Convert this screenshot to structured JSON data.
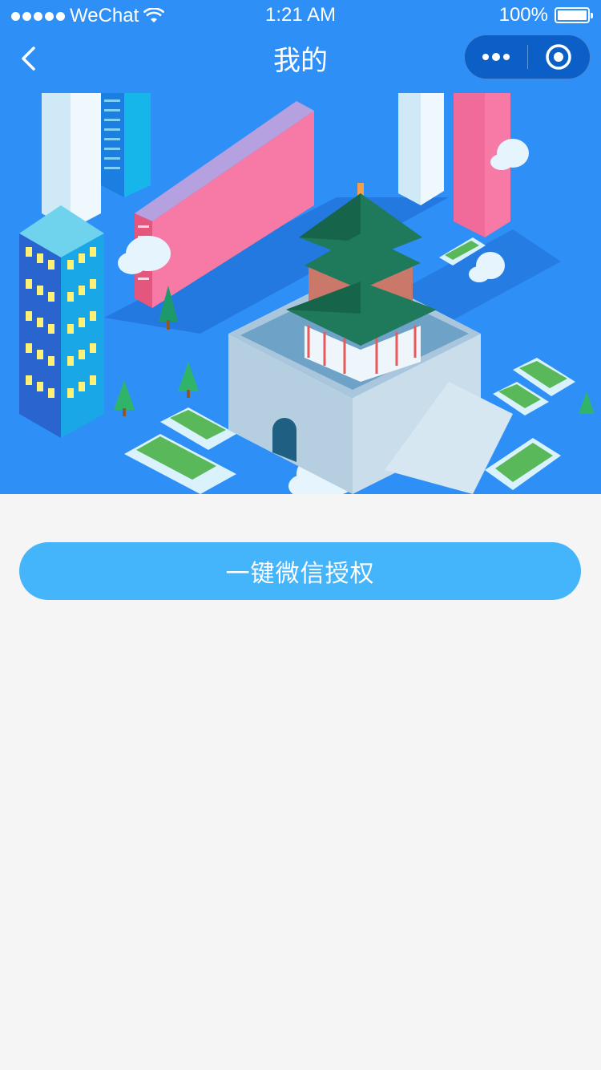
{
  "status_bar": {
    "carrier": "WeChat",
    "time": "1:21 AM",
    "battery": "100%",
    "battery_level": 1.0
  },
  "nav": {
    "title": "我的",
    "back_icon": "chevron-left-icon",
    "more_icon": "more-dots-icon",
    "close_icon": "target-circle-icon"
  },
  "banner": {
    "description_icon": "isometric-city-bell-tower-illustration"
  },
  "auth_button": {
    "label": "一键微信授权"
  },
  "colors": {
    "nav_blue": "#2e8ff7",
    "capsule": "#0b5fc7",
    "button": "#44b4fb",
    "page_bg": "#f5f5f5"
  }
}
